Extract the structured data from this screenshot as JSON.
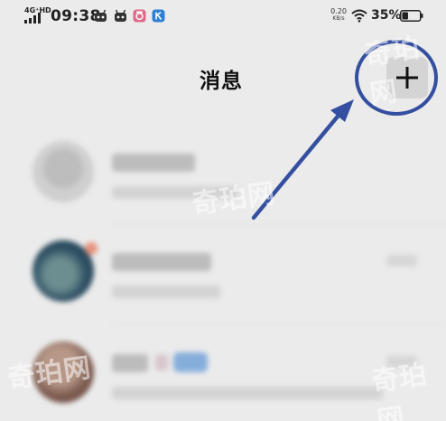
{
  "status_bar": {
    "network_label": "4G⁺HD",
    "time": "09:38",
    "app_icons": [
      "robot-icon",
      "robot-icon",
      "camera-icon",
      "k-app-icon"
    ],
    "net_speed_value": "0.20",
    "net_speed_unit": "KB/s",
    "battery_percent": "35%",
    "battery_level": 0.35
  },
  "header": {
    "title": "消息",
    "add_button_icon": "plus-icon"
  },
  "annotation": {
    "color": "#344fa0"
  },
  "watermark": {
    "text": "奇珀网"
  },
  "colors": {
    "background": "#ebebeb",
    "annotation": "#344fa0"
  }
}
